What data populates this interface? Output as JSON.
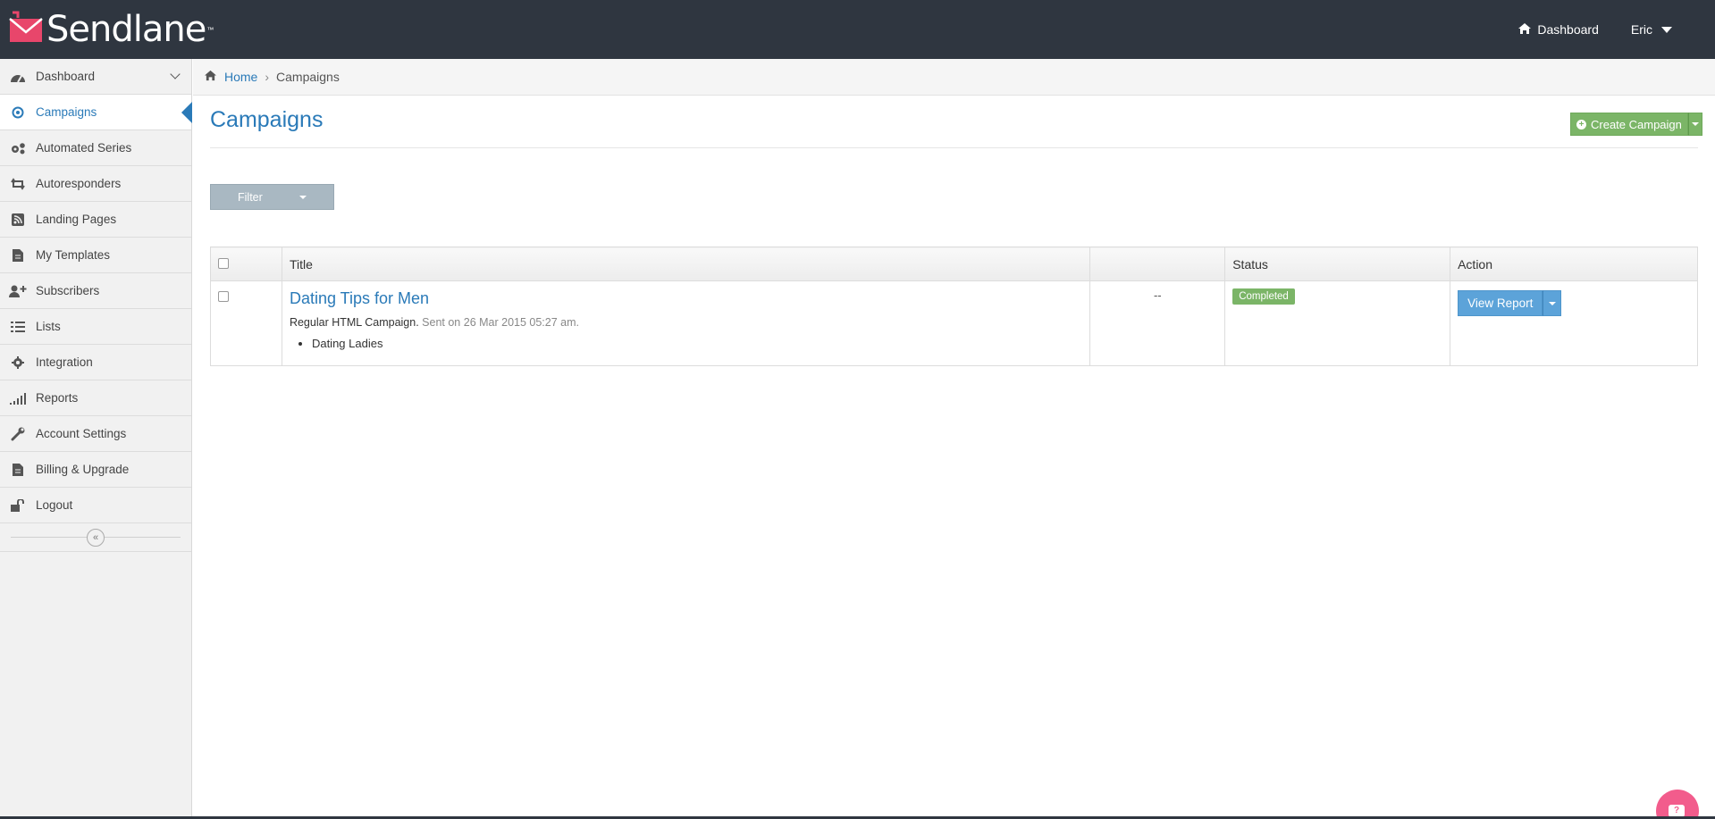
{
  "brand": {
    "name": "Sendlane",
    "tm": "™",
    "accent": "#2a7ab8",
    "topbar_color": "#2f3640"
  },
  "topnav": {
    "dashboard_label": "Dashboard",
    "user_name": "Eric"
  },
  "sidebar": {
    "items": [
      {
        "label": "Dashboard",
        "icon": "dashboard-icon"
      },
      {
        "label": "Campaigns",
        "icon": "compass-icon"
      },
      {
        "label": "Automated Series",
        "icon": "gears-icon"
      },
      {
        "label": "Autoresponders",
        "icon": "retweet-icon"
      },
      {
        "label": "Landing Pages",
        "icon": "rss-icon"
      },
      {
        "label": "My Templates",
        "icon": "file-icon"
      },
      {
        "label": "Subscribers",
        "icon": "user-plus-icon"
      },
      {
        "label": "Lists",
        "icon": "list-icon"
      },
      {
        "label": "Integration",
        "icon": "gear-icon"
      },
      {
        "label": "Reports",
        "icon": "signal-icon"
      },
      {
        "label": "Account Settings",
        "icon": "wrench-icon"
      },
      {
        "label": "Billing & Upgrade",
        "icon": "file-icon"
      },
      {
        "label": "Logout",
        "icon": "unlock-icon"
      }
    ],
    "collapse_glyph": "«"
  },
  "breadcrumb": {
    "home": "Home",
    "current": "Campaigns"
  },
  "main": {
    "title": "Campaigns",
    "create_label": "Create Campaign",
    "filter_label": "Filter"
  },
  "table": {
    "headers": {
      "title": "Title",
      "blank": "",
      "status": "Status",
      "action": "Action"
    },
    "rows": [
      {
        "title": "Dating Tips for Men",
        "type": "Regular HTML Campaign.",
        "sent": "Sent on 26 Mar 2015 05:27 am.",
        "lists": [
          "Dating Ladies"
        ],
        "stat": "--",
        "status": "Completed",
        "action_label": "View Report"
      }
    ]
  },
  "help": {
    "glyph": "?"
  }
}
